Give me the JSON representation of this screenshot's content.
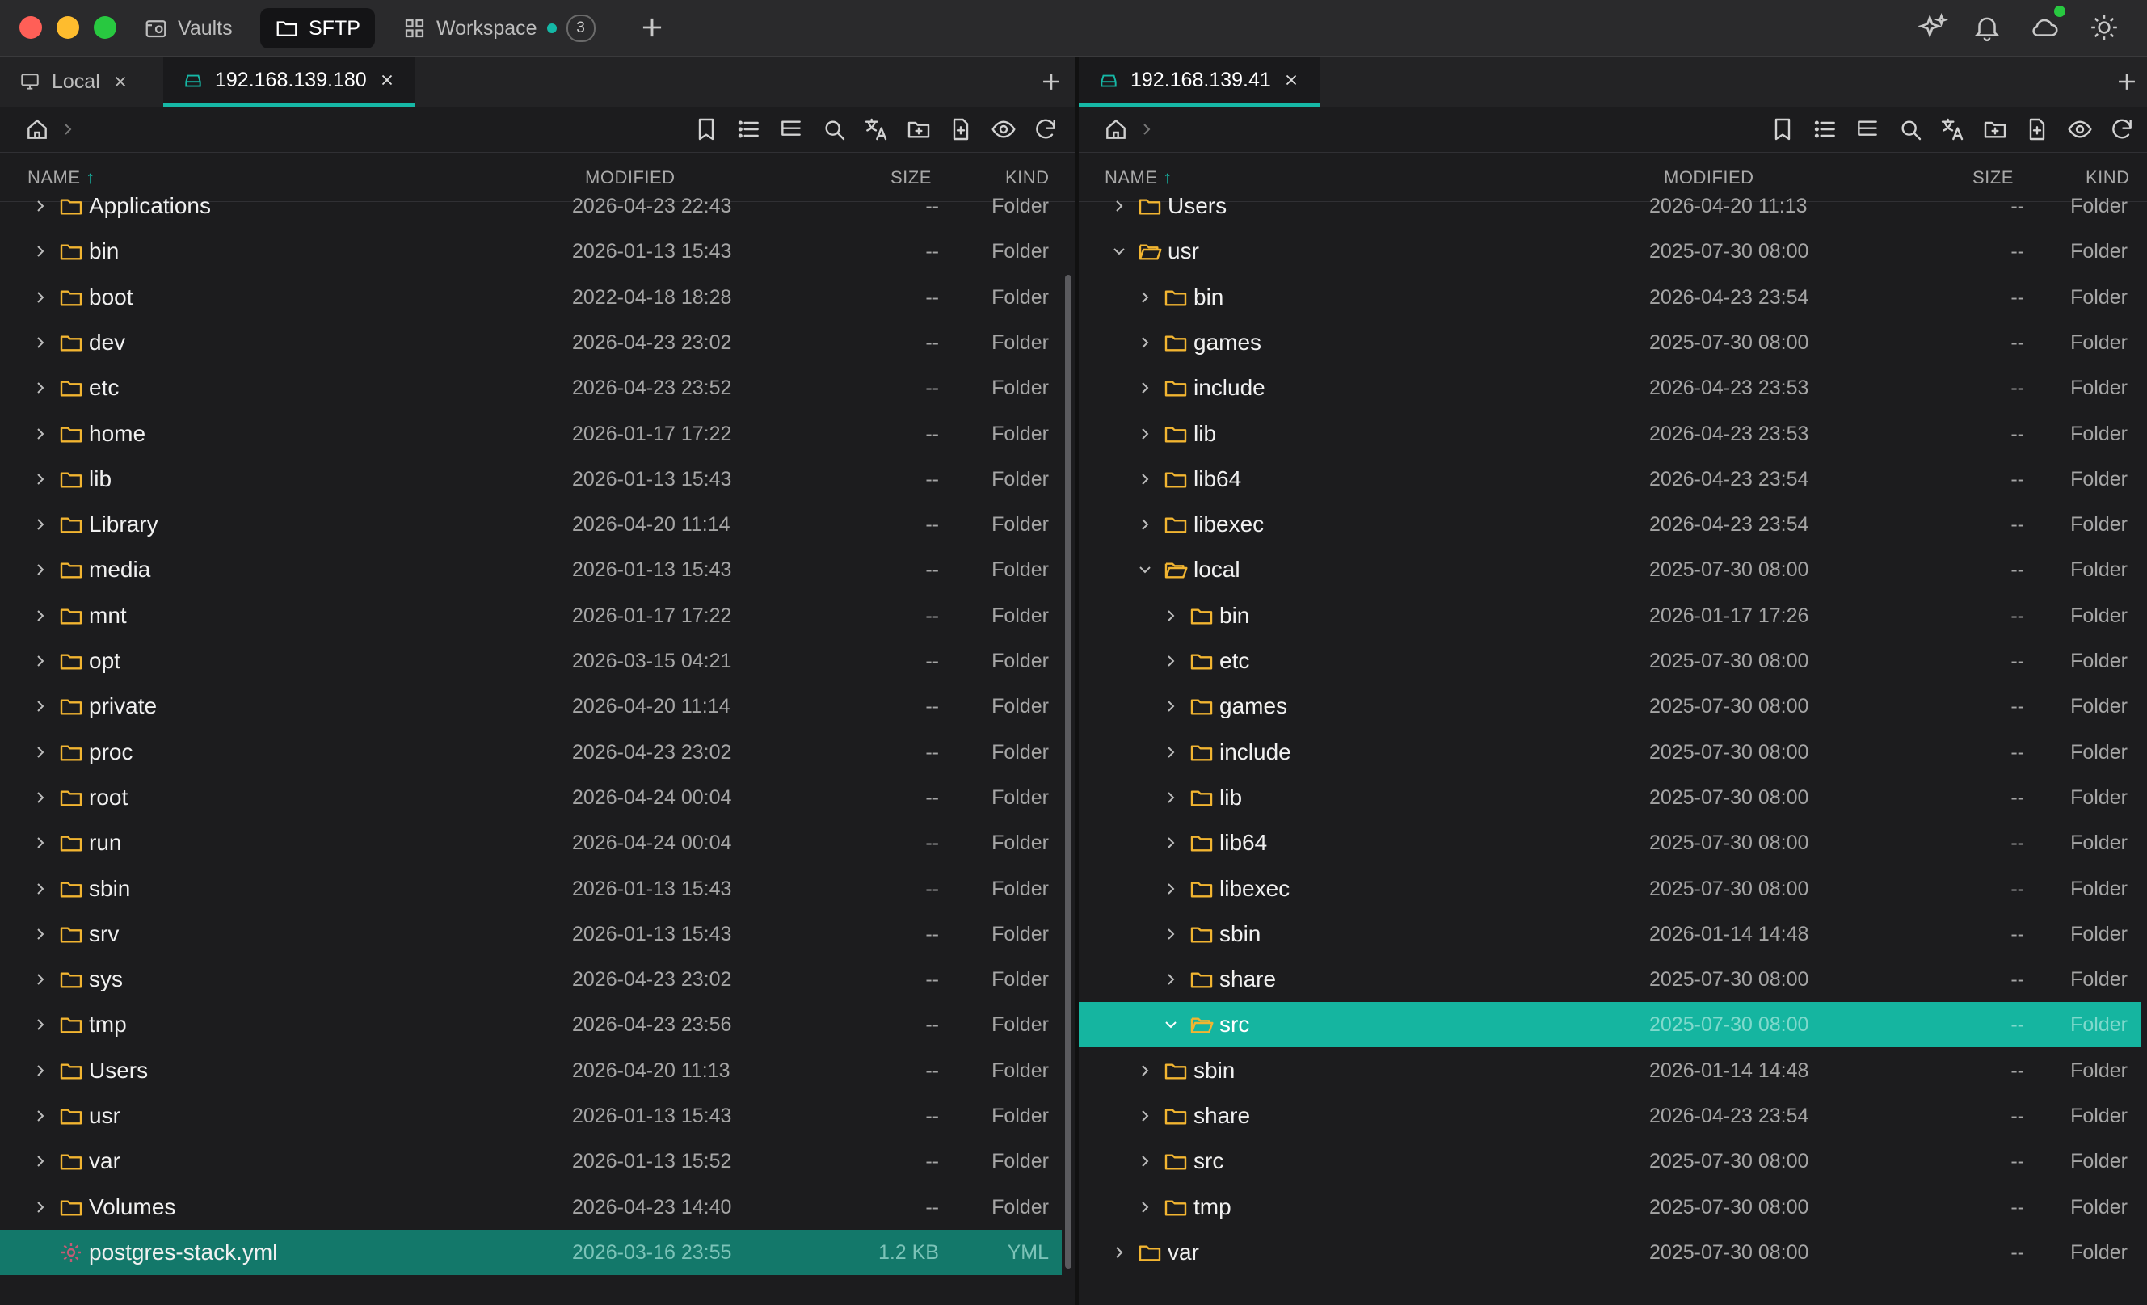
{
  "titlebar": {
    "tabs": [
      {
        "label": "Vaults",
        "icon": "vault-icon"
      },
      {
        "label": "SFTP",
        "icon": "folder-icon"
      },
      {
        "label": "Workspace",
        "icon": "grid-icon",
        "badge": "3",
        "status_color": "#14b8a6"
      }
    ],
    "right_icons": [
      "sparkle-icon",
      "bell-icon",
      "cloud-icon",
      "sun-icon"
    ]
  },
  "left": {
    "tabs": [
      {
        "label": "Local"
      },
      {
        "label": "192.168.139.180"
      }
    ],
    "columns": {
      "name": "NAME",
      "modified": "MODIFIED",
      "size": "SIZE",
      "kind": "KIND"
    },
    "rows": [
      {
        "name": "Applications",
        "modified": "2026-04-23 22:43",
        "size": "--",
        "kind": "Folder"
      },
      {
        "name": "bin",
        "modified": "2026-01-13 15:43",
        "size": "--",
        "kind": "Folder"
      },
      {
        "name": "boot",
        "modified": "2022-04-18 18:28",
        "size": "--",
        "kind": "Folder"
      },
      {
        "name": "dev",
        "modified": "2026-04-23 23:02",
        "size": "--",
        "kind": "Folder"
      },
      {
        "name": "etc",
        "modified": "2026-04-23 23:52",
        "size": "--",
        "kind": "Folder"
      },
      {
        "name": "home",
        "modified": "2026-01-17 17:22",
        "size": "--",
        "kind": "Folder"
      },
      {
        "name": "lib",
        "modified": "2026-01-13 15:43",
        "size": "--",
        "kind": "Folder"
      },
      {
        "name": "Library",
        "modified": "2026-04-20 11:14",
        "size": "--",
        "kind": "Folder"
      },
      {
        "name": "media",
        "modified": "2026-01-13 15:43",
        "size": "--",
        "kind": "Folder"
      },
      {
        "name": "mnt",
        "modified": "2026-01-17 17:22",
        "size": "--",
        "kind": "Folder"
      },
      {
        "name": "opt",
        "modified": "2026-03-15 04:21",
        "size": "--",
        "kind": "Folder"
      },
      {
        "name": "private",
        "modified": "2026-04-20 11:14",
        "size": "--",
        "kind": "Folder"
      },
      {
        "name": "proc",
        "modified": "2026-04-23 23:02",
        "size": "--",
        "kind": "Folder"
      },
      {
        "name": "root",
        "modified": "2026-04-24 00:04",
        "size": "--",
        "kind": "Folder"
      },
      {
        "name": "run",
        "modified": "2026-04-24 00:04",
        "size": "--",
        "kind": "Folder"
      },
      {
        "name": "sbin",
        "modified": "2026-01-13 15:43",
        "size": "--",
        "kind": "Folder"
      },
      {
        "name": "srv",
        "modified": "2026-01-13 15:43",
        "size": "--",
        "kind": "Folder"
      },
      {
        "name": "sys",
        "modified": "2026-04-23 23:02",
        "size": "--",
        "kind": "Folder"
      },
      {
        "name": "tmp",
        "modified": "2026-04-23 23:56",
        "size": "--",
        "kind": "Folder"
      },
      {
        "name": "Users",
        "modified": "2026-04-20 11:13",
        "size": "--",
        "kind": "Folder"
      },
      {
        "name": "usr",
        "modified": "2026-01-13 15:43",
        "size": "--",
        "kind": "Folder"
      },
      {
        "name": "var",
        "modified": "2026-01-13 15:52",
        "size": "--",
        "kind": "Folder"
      },
      {
        "name": "Volumes",
        "modified": "2026-04-23 14:40",
        "size": "--",
        "kind": "Folder"
      },
      {
        "name": "postgres-stack.yml",
        "modified": "2026-03-16 23:55",
        "size": "1.2 KB",
        "kind": "YML",
        "type": "file",
        "selected": true
      }
    ]
  },
  "right": {
    "tabs": [
      {
        "label": "192.168.139.41"
      }
    ],
    "columns": {
      "name": "NAME",
      "modified": "MODIFIED",
      "size": "SIZE",
      "kind": "KIND"
    },
    "rows": [
      {
        "name": "Users",
        "modified": "2026-04-20 11:13",
        "size": "--",
        "kind": "Folder",
        "depth": 0
      },
      {
        "name": "usr",
        "modified": "2025-07-30 08:00",
        "size": "--",
        "kind": "Folder",
        "depth": 0,
        "expanded": true
      },
      {
        "name": "bin",
        "modified": "2026-04-23 23:54",
        "size": "--",
        "kind": "Folder",
        "depth": 1
      },
      {
        "name": "games",
        "modified": "2025-07-30 08:00",
        "size": "--",
        "kind": "Folder",
        "depth": 1
      },
      {
        "name": "include",
        "modified": "2026-04-23 23:53",
        "size": "--",
        "kind": "Folder",
        "depth": 1
      },
      {
        "name": "lib",
        "modified": "2026-04-23 23:53",
        "size": "--",
        "kind": "Folder",
        "depth": 1
      },
      {
        "name": "lib64",
        "modified": "2026-04-23 23:54",
        "size": "--",
        "kind": "Folder",
        "depth": 1
      },
      {
        "name": "libexec",
        "modified": "2026-04-23 23:54",
        "size": "--",
        "kind": "Folder",
        "depth": 1
      },
      {
        "name": "local",
        "modified": "2025-07-30 08:00",
        "size": "--",
        "kind": "Folder",
        "depth": 1,
        "expanded": true
      },
      {
        "name": "bin",
        "modified": "2026-01-17 17:26",
        "size": "--",
        "kind": "Folder",
        "depth": 2
      },
      {
        "name": "etc",
        "modified": "2025-07-30 08:00",
        "size": "--",
        "kind": "Folder",
        "depth": 2
      },
      {
        "name": "games",
        "modified": "2025-07-30 08:00",
        "size": "--",
        "kind": "Folder",
        "depth": 2
      },
      {
        "name": "include",
        "modified": "2025-07-30 08:00",
        "size": "--",
        "kind": "Folder",
        "depth": 2
      },
      {
        "name": "lib",
        "modified": "2025-07-30 08:00",
        "size": "--",
        "kind": "Folder",
        "depth": 2
      },
      {
        "name": "lib64",
        "modified": "2025-07-30 08:00",
        "size": "--",
        "kind": "Folder",
        "depth": 2
      },
      {
        "name": "libexec",
        "modified": "2025-07-30 08:00",
        "size": "--",
        "kind": "Folder",
        "depth": 2
      },
      {
        "name": "sbin",
        "modified": "2026-01-14 14:48",
        "size": "--",
        "kind": "Folder",
        "depth": 2
      },
      {
        "name": "share",
        "modified": "2025-07-30 08:00",
        "size": "--",
        "kind": "Folder",
        "depth": 2
      },
      {
        "name": "src",
        "modified": "2025-07-30 08:00",
        "size": "--",
        "kind": "Folder",
        "depth": 2,
        "expanded": true,
        "selected": true
      },
      {
        "name": "sbin",
        "modified": "2026-01-14 14:48",
        "size": "--",
        "kind": "Folder",
        "depth": 1
      },
      {
        "name": "share",
        "modified": "2026-04-23 23:54",
        "size": "--",
        "kind": "Folder",
        "depth": 1
      },
      {
        "name": "src",
        "modified": "2025-07-30 08:00",
        "size": "--",
        "kind": "Folder",
        "depth": 1
      },
      {
        "name": "tmp",
        "modified": "2025-07-30 08:00",
        "size": "--",
        "kind": "Folder",
        "depth": 1
      },
      {
        "name": "var",
        "modified": "2025-07-30 08:00",
        "size": "--",
        "kind": "Folder",
        "depth": 0
      }
    ]
  },
  "toolbar_icons": [
    "bookmark-icon",
    "list-view-icon",
    "tree-view-icon",
    "search-icon",
    "translate-icon",
    "new-folder-icon",
    "new-file-icon",
    "show-hidden-icon",
    "refresh-icon"
  ],
  "colors": {
    "accent": "#14b8a6",
    "folder": "#f2b531",
    "selected_dark": "#13786a"
  }
}
